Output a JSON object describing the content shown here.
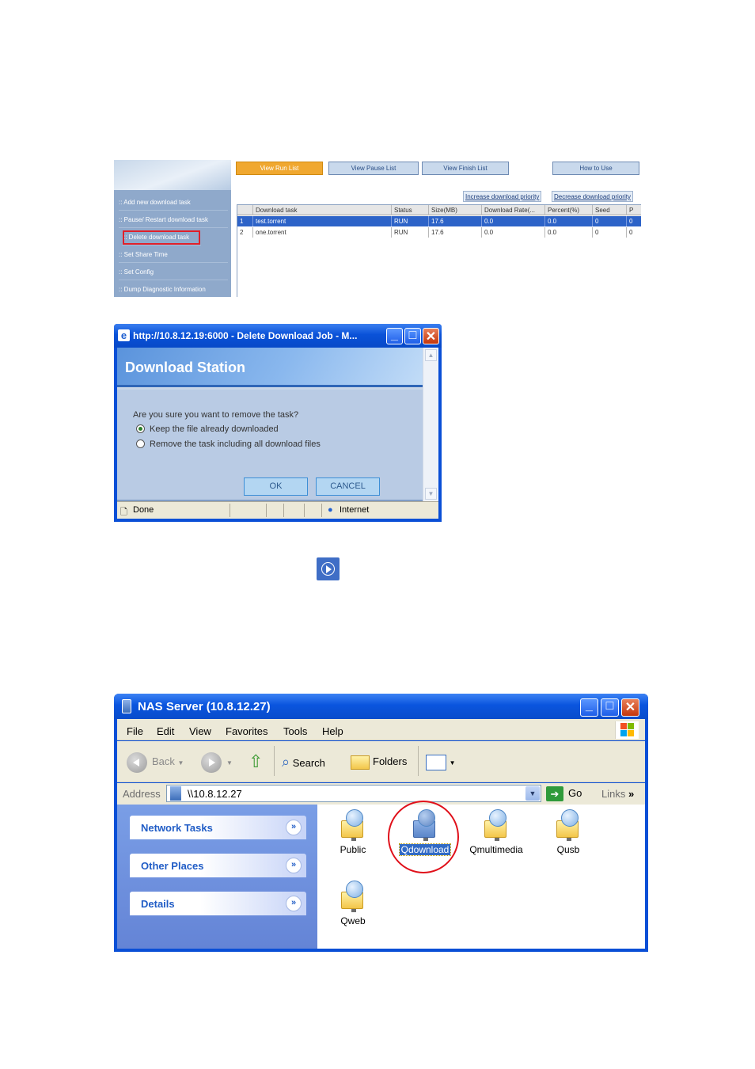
{
  "download_station_panel": {
    "top_buttons": [
      "View Run List",
      "View Pause List",
      "View Finish List",
      "How to Use"
    ],
    "sidebar_items": [
      "Add new download task",
      "Pause/ Restart download task",
      "Delete download task",
      "Set Share Time",
      "Set Config",
      "Dump Diagnostic Information"
    ],
    "priority_buttons": [
      "Increase download priority",
      "Decrease download priority"
    ],
    "table": {
      "columns": [
        "",
        "Download task",
        "Status",
        "Size(MB)",
        "Download Rate(...",
        "Percent(%)",
        "Seed",
        "P"
      ],
      "rows": [
        [
          "1",
          "test.torrent",
          "RUN",
          "17.6",
          "0.0",
          "0.0",
          "0",
          "0"
        ],
        [
          "2",
          "one.torrent",
          "RUN",
          "17.6",
          "0.0",
          "0.0",
          "0",
          "0"
        ]
      ]
    }
  },
  "delete_dialog": {
    "title": "http://10.8.12.19:6000 - Delete Download Job - M...",
    "header": "Download Station",
    "question": "Are you sure you want to remove the task?",
    "options": [
      "Keep the file already downloaded",
      "Remove the task including all download files"
    ],
    "ok_label": "OK",
    "cancel_label": "CANCEL",
    "status_left": "Done",
    "status_zone": "Internet"
  },
  "explorer": {
    "title": "NAS Server (10.8.12.27)",
    "menu": [
      "File",
      "Edit",
      "View",
      "Favorites",
      "Tools",
      "Help"
    ],
    "toolbar": {
      "back": "Back",
      "search": "Search",
      "folders": "Folders"
    },
    "address_label": "Address",
    "address_value": "\\\\10.8.12.27",
    "go_label": "Go",
    "links_label": "Links",
    "links_chevron": "»",
    "task_panels": [
      "Network Tasks",
      "Other Places",
      "Details"
    ],
    "shares": [
      "Public",
      "Qdownload",
      "Qmultimedia",
      "Qusb",
      "Qweb"
    ],
    "selected_share": "Qdownload"
  },
  "icons": {
    "play": "play-circle-icon",
    "expand": "chevron-double-down-icon"
  },
  "colors": {
    "active_tab": "#f0a830",
    "selection": "#2d63c8",
    "highlight_outline": "#e0202a",
    "xp_title": "#0a55de"
  }
}
